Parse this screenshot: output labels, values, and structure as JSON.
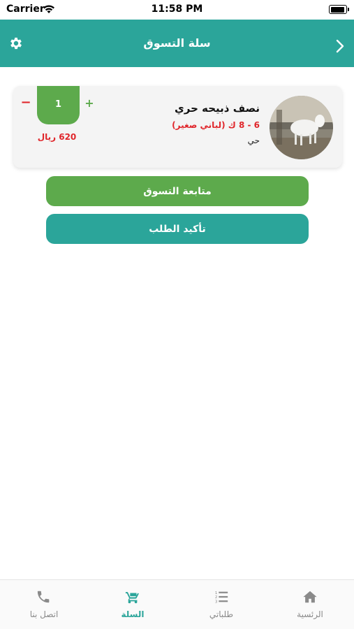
{
  "status_bar": {
    "carrier": "Carrier",
    "time": "11:58 PM"
  },
  "header": {
    "title": "سلة التسوق"
  },
  "cart": {
    "items": [
      {
        "name": "نصف ذبيحه حري",
        "weight": "6 - 8 ك (لباني صغير)",
        "type": "حي",
        "quantity": "1",
        "minus": "−",
        "plus": "+",
        "price": "620 ريال"
      }
    ]
  },
  "buttons": {
    "continue_shopping": "متابعة التسوق",
    "confirm_order": "تأكيد الطلب"
  },
  "tabs": [
    {
      "label": "اتصل بنا",
      "icon": "phone-icon"
    },
    {
      "label": "السلة",
      "icon": "cart-icon",
      "active": true
    },
    {
      "label": "طلباتي",
      "icon": "list-icon"
    },
    {
      "label": "الرئسية",
      "icon": "home-icon"
    }
  ],
  "colors": {
    "primary": "#2ba59a",
    "green": "#5daa4c",
    "red": "#e0262b"
  }
}
